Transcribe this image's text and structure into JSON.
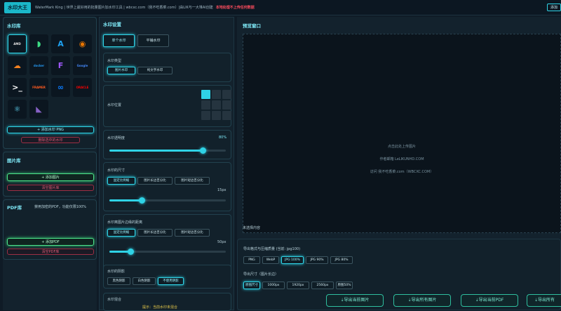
{
  "header": {
    "logo": "水印大王",
    "info": "WaterMark King | 世界上最好用的批量图片加水印工具 | wbcxc.com（我不吃香菜.com）|由LIK与一大堆AI创建",
    "warning": "本地处理不上传任何数据",
    "button": "添加"
  },
  "library": {
    "title": "水印库",
    "icons": [
      {
        "name": "amd",
        "text": "AMD",
        "color": "#e6e6e6"
      },
      {
        "name": "android",
        "text": "◗",
        "color": "#3ddc84"
      },
      {
        "name": "app-store",
        "text": "A",
        "color": "#1ea1f2"
      },
      {
        "name": "blender",
        "text": "◉",
        "color": "#ea7600"
      },
      {
        "name": "cloudflare",
        "text": "☁",
        "color": "#f48120"
      },
      {
        "name": "docker",
        "text": "docker",
        "color": "#2496ed"
      },
      {
        "name": "figma",
        "text": "F",
        "color": "#a259ff"
      },
      {
        "name": "google",
        "text": "Google",
        "color": "#4285f4"
      },
      {
        "name": "terminal",
        "text": ">_",
        "color": "#ffffff"
      },
      {
        "name": "framer",
        "text": "FRAMER",
        "color": "#ff5a1f"
      },
      {
        "name": "meta",
        "text": "∞",
        "color": "#0a7cff"
      },
      {
        "name": "oracle",
        "text": "ORACLE",
        "color": "#f80000"
      },
      {
        "name": "react",
        "text": "⚛",
        "color": "#61dafb"
      },
      {
        "name": "visual-studio",
        "text": "◣",
        "color": "#8661c5"
      }
    ],
    "add_button": "+ 添加水印 PNG",
    "delete_button": "删除选中的水印"
  },
  "images": {
    "title": "图片库",
    "add_button": "+ 添加图片",
    "clear_button": "清空图片库"
  },
  "pdf": {
    "title": "PDF库",
    "note": "禁用加密的PDF，功能仅限100%",
    "add_button": "+ 添加PDF",
    "clear_button": "清空PDF库"
  },
  "settings": {
    "title": "水印设置",
    "mode_tabs": [
      "单个水印",
      "平铺水印"
    ],
    "mode_selected": 0,
    "type_label": "水印类型",
    "type_options": [
      "图片水印",
      "纯文字水印"
    ],
    "type_selected": 0,
    "position_label": "水印位置",
    "position_selected": 0,
    "opacity_label": "水印透明度",
    "opacity_value": "80%",
    "opacity": 0.8,
    "size_label": "水印的尺寸",
    "size_options": [
      "固定比例缩",
      "图片长边百分比",
      "图片短边百分比"
    ],
    "size_selected": 0,
    "size_value": "15px",
    "size_level": 0.28,
    "margin_label": "水印离图片边缘的距离",
    "margin_options": [
      "固定比例缩",
      "图片长边百分比",
      "图片短边百分比"
    ],
    "margin_selected": 0,
    "margin_value": "50px",
    "margin_level": 0.18,
    "shadow_label": "水印的阴影",
    "shadow_options": [
      "黑色阴影",
      "白色阴影",
      "不使用阴影"
    ],
    "shadow_selected": 2,
    "blend_label": "水印混合",
    "blend_note": "提示：当前水印未混合"
  },
  "preview": {
    "title": "预览窗口",
    "hint1": "点击此处上传图片",
    "hint2": "作者邮箱 LeLIKUNHD.COM",
    "hint3": "访问 我不吃香菜.com（WBCXC.COM）",
    "no_content": "未选择内容",
    "format_label": "导出格式与压缩质量 (当前: jpg100)",
    "format_options": [
      "PNG",
      "WebP",
      "JPG 100%",
      "JPG 90%",
      "JPG 80%"
    ],
    "format_selected": 2,
    "size_label": "导出尺寸（图片长边）",
    "size_options": [
      "原图尺寸",
      "1000px",
      "1920px",
      "2560px",
      "原图50%"
    ],
    "size_selected": 0,
    "export_buttons": [
      "⇣导出当前图片",
      "⇣导出所有图片",
      "⇣导出当前PDF",
      "⇣导出所有"
    ]
  },
  "colors": {
    "accent": "#2fd3e6",
    "green": "#4ee38a",
    "danger": "#ff4d5e"
  }
}
